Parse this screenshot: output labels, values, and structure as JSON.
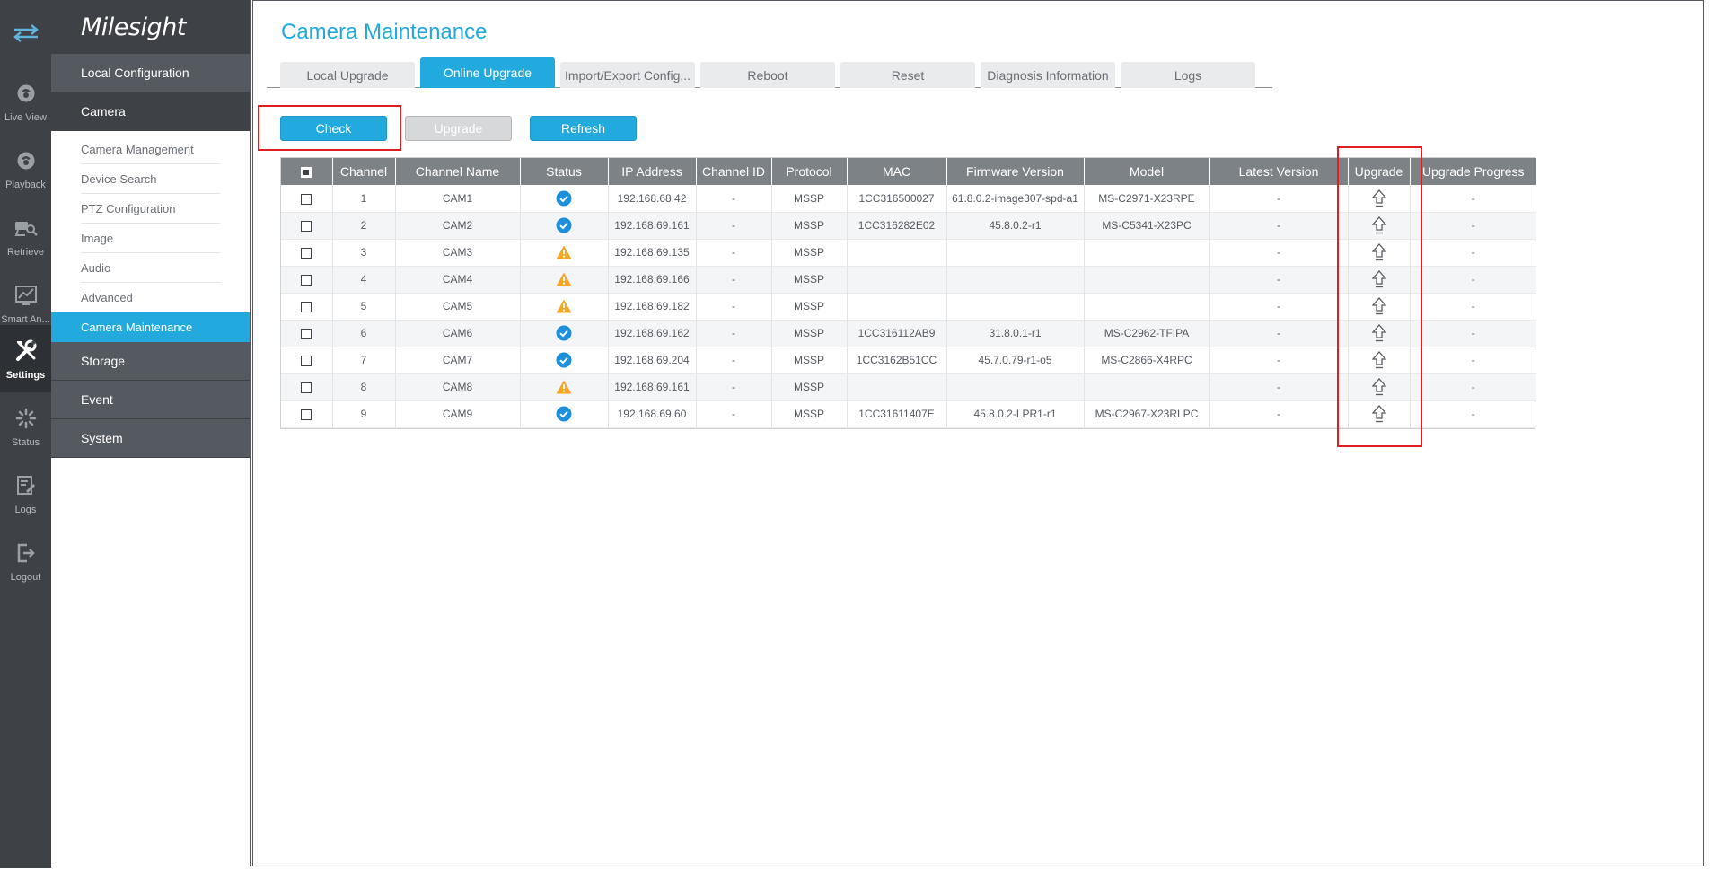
{
  "brand": "Milesight",
  "rail": [
    {
      "label": "",
      "icon": "swap-arrows-icon"
    },
    {
      "label": "Live View",
      "icon": "live-view-icon"
    },
    {
      "label": "Playback",
      "icon": "playback-icon"
    },
    {
      "label": "Retrieve",
      "icon": "retrieve-icon"
    },
    {
      "label": "Smart An...",
      "icon": "smart-analytics-icon"
    },
    {
      "label": "Settings",
      "icon": "settings-wrench-icon",
      "active": true
    },
    {
      "label": "Status",
      "icon": "status-icon"
    },
    {
      "label": "Logs",
      "icon": "logs-icon"
    },
    {
      "label": "Logout",
      "icon": "logout-icon"
    }
  ],
  "menu": {
    "local_configuration": "Local Configuration",
    "camera": "Camera",
    "camera_items": [
      "Camera Management",
      "Device Search",
      "PTZ Configuration",
      "Image",
      "Audio",
      "Advanced",
      "Camera Maintenance"
    ],
    "storage": "Storage",
    "event": "Event",
    "system": "System"
  },
  "page_title": "Camera Maintenance",
  "tabs": [
    "Local Upgrade",
    "Online Upgrade",
    "Import/Export Config...",
    "Reboot",
    "Reset",
    "Diagnosis Information",
    "Logs"
  ],
  "active_tab": "Online Upgrade",
  "buttons": {
    "check": "Check",
    "upgrade": "Upgrade",
    "refresh": "Refresh"
  },
  "table": {
    "headers": [
      "",
      "Channel",
      "Channel Name",
      "Status",
      "IP Address",
      "Channel ID",
      "Protocol",
      "MAC",
      "Firmware Version",
      "Model",
      "Latest Version",
      "Upgrade",
      "Upgrade Progress"
    ],
    "rows": [
      {
        "channel": "1",
        "name": "CAM1",
        "status": "connected",
        "ip": "192.168.68.42",
        "channel_id": "-",
        "protocol": "MSSP",
        "mac": "1CC316500027",
        "firmware": "61.8.0.2-image307-spd-a1",
        "model": "MS-C2971-X23RPE",
        "latest": "-",
        "progress": "-"
      },
      {
        "channel": "2",
        "name": "CAM2",
        "status": "connected",
        "ip": "192.168.69.161",
        "channel_id": "-",
        "protocol": "MSSP",
        "mac": "1CC316282E02",
        "firmware": "45.8.0.2-r1",
        "model": "MS-C5341-X23PC",
        "latest": "-",
        "progress": "-"
      },
      {
        "channel": "3",
        "name": "CAM3",
        "status": "warning",
        "ip": "192.168.69.135",
        "channel_id": "-",
        "protocol": "MSSP",
        "mac": "",
        "firmware": "",
        "model": "",
        "latest": "-",
        "progress": "-"
      },
      {
        "channel": "4",
        "name": "CAM4",
        "status": "warning",
        "ip": "192.168.69.166",
        "channel_id": "-",
        "protocol": "MSSP",
        "mac": "",
        "firmware": "",
        "model": "",
        "latest": "-",
        "progress": "-"
      },
      {
        "channel": "5",
        "name": "CAM5",
        "status": "warning",
        "ip": "192.168.69.182",
        "channel_id": "-",
        "protocol": "MSSP",
        "mac": "",
        "firmware": "",
        "model": "",
        "latest": "-",
        "progress": "-"
      },
      {
        "channel": "6",
        "name": "CAM6",
        "status": "connected",
        "ip": "192.168.69.162",
        "channel_id": "-",
        "protocol": "MSSP",
        "mac": "1CC316112AB9",
        "firmware": "31.8.0.1-r1",
        "model": "MS-C2962-TFIPA",
        "latest": "-",
        "progress": "-"
      },
      {
        "channel": "7",
        "name": "CAM7",
        "status": "connected",
        "ip": "192.168.69.204",
        "channel_id": "-",
        "protocol": "MSSP",
        "mac": "1CC3162B51CC",
        "firmware": "45.7.0.79-r1-o5",
        "model": "MS-C2866-X4RPC",
        "latest": "-",
        "progress": "-"
      },
      {
        "channel": "8",
        "name": "CAM8",
        "status": "warning",
        "ip": "192.168.69.161",
        "channel_id": "-",
        "protocol": "MSSP",
        "mac": "",
        "firmware": "",
        "model": "",
        "latest": "-",
        "progress": "-"
      },
      {
        "channel": "9",
        "name": "CAM9",
        "status": "connected",
        "ip": "192.168.69.60",
        "channel_id": "-",
        "protocol": "MSSP",
        "mac": "1CC31611407E",
        "firmware": "45.8.0.2-LPR1-r1",
        "model": "MS-C2967-X23RLPC",
        "latest": "-",
        "progress": "-"
      }
    ]
  },
  "colors": {
    "accent": "#22a9de",
    "sidebar": "#3e4247",
    "highlight": "#e11d1d",
    "ok": "#1e8fdc",
    "warn": "#f5a623"
  }
}
